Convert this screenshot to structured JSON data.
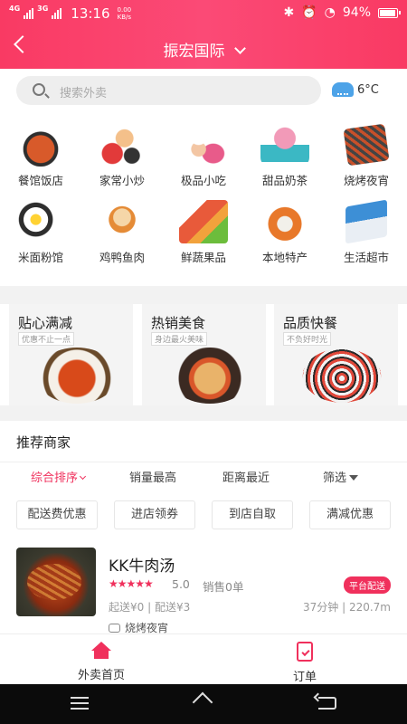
{
  "statusbar": {
    "network": "4G",
    "network2": "3G",
    "time": "13:16",
    "speed_value": "0.00",
    "speed_unit": "KB/s",
    "battery": "94%"
  },
  "navbar": {
    "title": "振宏国际"
  },
  "search": {
    "placeholder": "搜索外卖"
  },
  "weather": {
    "temp": "6°C"
  },
  "categories": [
    {
      "label": "餐馆饭店"
    },
    {
      "label": "家常小炒"
    },
    {
      "label": "极品小吃"
    },
    {
      "label": "甜品奶茶"
    },
    {
      "label": "烧烤夜宵"
    },
    {
      "label": "米面粉馆"
    },
    {
      "label": "鸡鸭鱼肉"
    },
    {
      "label": "鲜蔬果品"
    },
    {
      "label": "本地特产"
    },
    {
      "label": "生活超市"
    }
  ],
  "promos": [
    {
      "title": "贴心满减",
      "tag": "优惠不止一点"
    },
    {
      "title": "热销美食",
      "tag": "身边最火美味"
    },
    {
      "title": "品质快餐",
      "tag": "不负好时光"
    }
  ],
  "recommend": {
    "title": "推荐商家",
    "sort": [
      "综合排序",
      "销量最高",
      "距离最近",
      "筛选"
    ],
    "chips": [
      "配送费优惠",
      "进店领券",
      "到店自取",
      "满减优惠"
    ]
  },
  "shop": {
    "name": "KK牛肉汤",
    "stars": "★★★★★",
    "rating": "5.0",
    "sales": "销售0单",
    "badge": "平台配送",
    "fee": "起送¥0 | 配送¥3",
    "distance": "37分钟 | 220.7m",
    "category": "烧烤夜宵"
  },
  "tabbar": [
    {
      "label": "外卖首页"
    },
    {
      "label": "订单"
    }
  ],
  "colors": {
    "accent": "#f0305c",
    "header": "#fb4a76"
  }
}
